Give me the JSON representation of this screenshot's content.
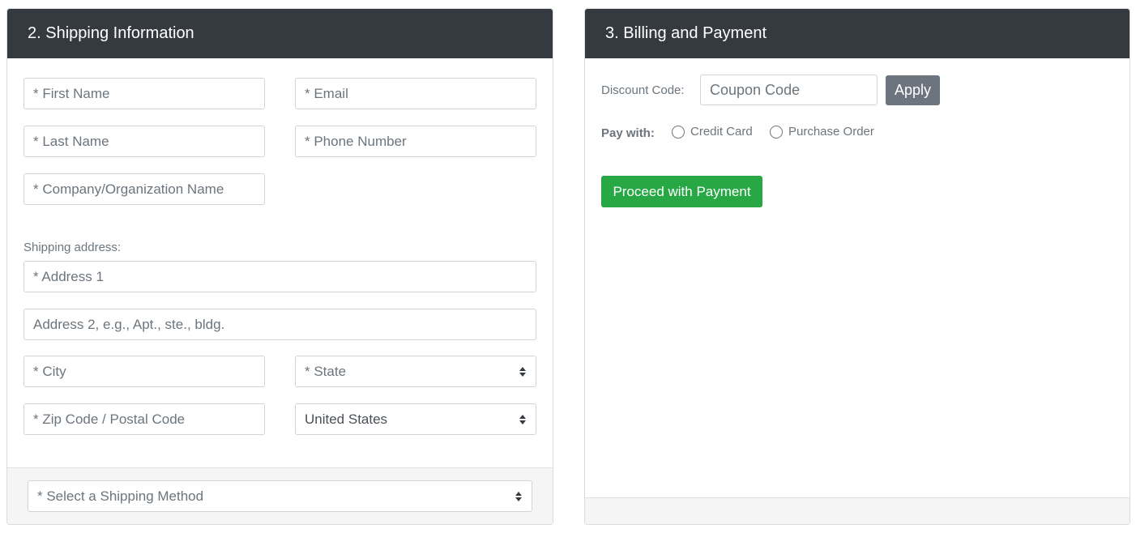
{
  "shipping": {
    "title": "2. Shipping Information",
    "first_name_ph": "* First Name",
    "email_ph": "* Email",
    "last_name_ph": "* Last Name",
    "phone_ph": "* Phone Number",
    "company_ph": "* Company/Organization Name",
    "address_label": "Shipping address:",
    "address1_ph": "* Address 1",
    "address2_ph": "Address 2, e.g., Apt., ste., bldg.",
    "city_ph": "* City",
    "state_value": "* State",
    "zip_ph": "* Zip Code / Postal Code",
    "country_value": "United States",
    "shipping_method_value": "* Select a Shipping Method"
  },
  "billing": {
    "title": "3. Billing and Payment",
    "discount_label": "Discount Code:",
    "coupon_ph": "Coupon Code",
    "apply_label": "Apply",
    "pay_with_label": "Pay with:",
    "option_credit_card": "Credit Card",
    "option_purchase_order": "Purchase Order",
    "proceed_label": "Proceed with Payment"
  }
}
